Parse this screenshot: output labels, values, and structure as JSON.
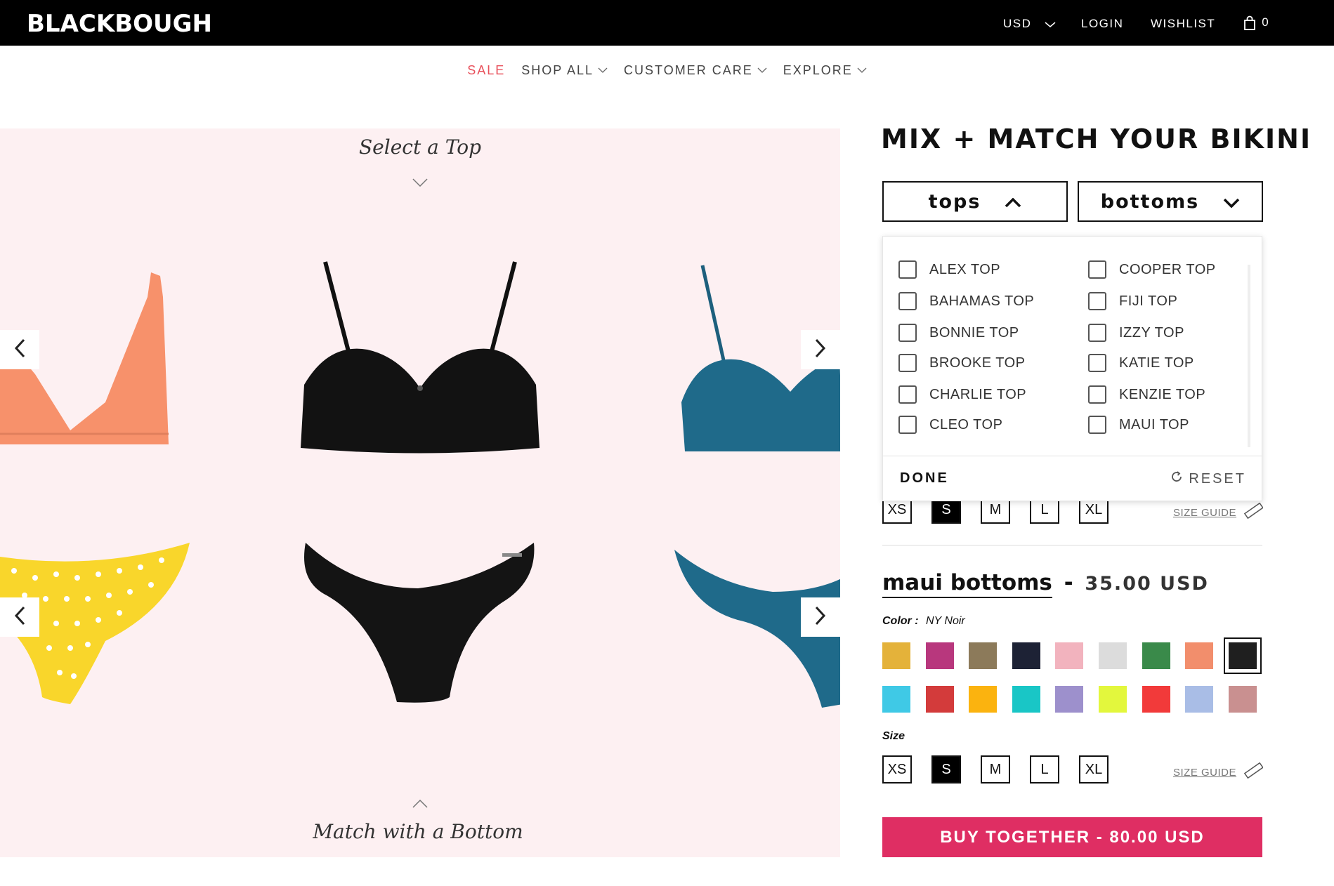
{
  "header": {
    "logo": "BLACKBOUGH",
    "currency": "USD",
    "login": "LOGIN",
    "wishlist": "WISHLIST",
    "cart_count": "0"
  },
  "nav": {
    "items": [
      {
        "label": "SALE"
      },
      {
        "label": "SHOP ALL"
      },
      {
        "label": "CUSTOMER CARE"
      },
      {
        "label": "EXPLORE"
      }
    ]
  },
  "stage": {
    "top_label": "Select a Top",
    "bottom_label": "Match with a Bottom"
  },
  "panel": {
    "title": "MIX + MATCH YOUR BIKINI",
    "tops_select": "tops",
    "bottoms_select": "bottoms",
    "dropdown": {
      "options_left": [
        "ALEX TOP",
        "BAHAMAS TOP",
        "BONNIE TOP",
        "BROOKE TOP",
        "CHARLIE TOP",
        "CLEO TOP"
      ],
      "options_right": [
        "COOPER TOP",
        "FIJI TOP",
        "IZZY TOP",
        "KATIE TOP",
        "KENZIE TOP",
        "MAUI TOP"
      ],
      "done": "DONE",
      "reset": "RESET"
    },
    "sizes": [
      "XS",
      "S",
      "M",
      "L",
      "XL"
    ],
    "selected_size": "S",
    "size_guide": "SIZE GUIDE",
    "bottoms": {
      "name": "maui bottoms",
      "separator": "-",
      "price": "35.00 USD",
      "color_label": "Color :",
      "color_value": "NY Noir",
      "size_label": "Size"
    },
    "swatches_row1": [
      "#e4b23a",
      "#b8377d",
      "#8c7a5a",
      "#1d2235",
      "#f2b3be",
      "#dcdcdc",
      "#3a8a4a",
      "#f28e6c",
      "#1f1f1f"
    ],
    "swatches_row2": [
      "#3fc9e6",
      "#d33b3b",
      "#fbb30f",
      "#19c6c6",
      "#9d90cc",
      "#e3f73d",
      "#f23a3a",
      "#a9bde6",
      "#c99090"
    ],
    "buy_button": "BUY TOGETHER - 80.00 USD"
  }
}
